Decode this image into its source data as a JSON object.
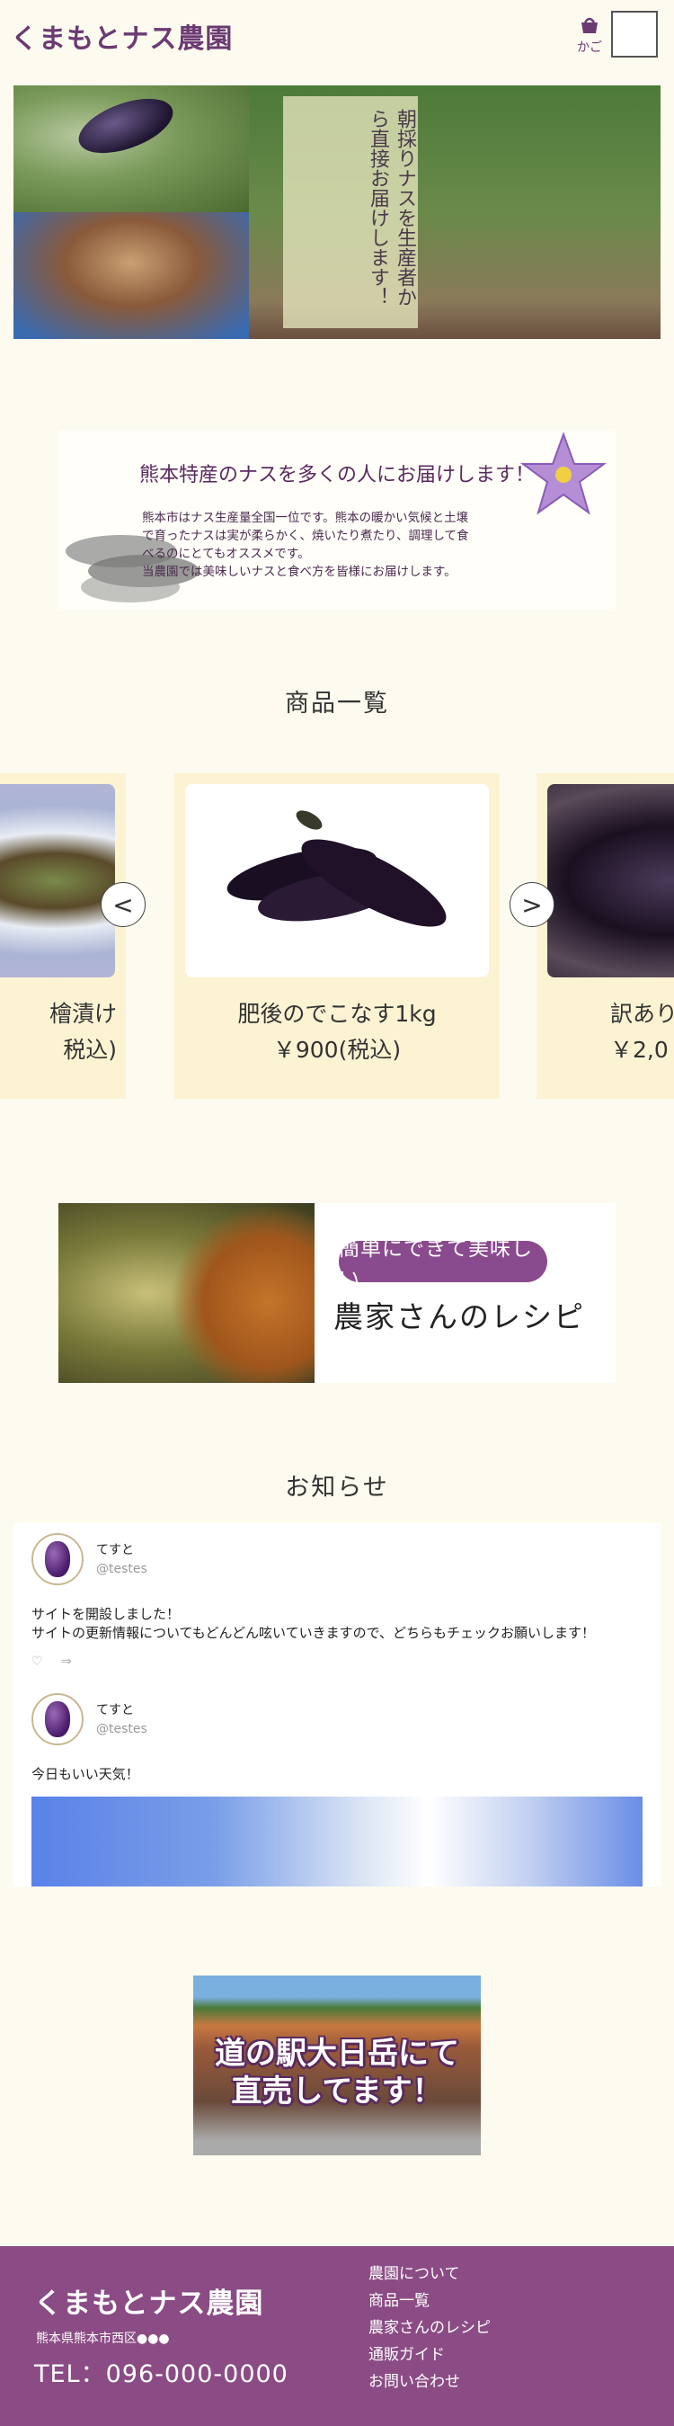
{
  "header": {
    "logo": "くまもとナス農園",
    "cart_label": "かご"
  },
  "hero": {
    "banner_text": "朝採りナスを生産者から直接お届けします！"
  },
  "intro": {
    "title": "熊本特産のナスを多くの人にお届けします！",
    "body_lines": [
      "熊本市はナス生産量全国一位です。熊本の暖かい気候と土壌",
      "で育ったナスは実が柔らかく、焼いたり煮たり、調理して食",
      "べるのにとてもオススメです。",
      "当農園では美味しいナスと食べ方を皆様にお届けします。"
    ]
  },
  "products": {
    "title": "商品一覧",
    "items": [
      {
        "name": "檜漬け",
        "price": "税込)"
      },
      {
        "name": "肥後のでこなす1kg",
        "price": "￥900(税込)"
      },
      {
        "name": "訳あり",
        "price": "￥2,0"
      }
    ],
    "prev_icon": "<",
    "next_icon": ">"
  },
  "recipe": {
    "pill": "簡単にできて美味しい",
    "title": "農家さんのレシピ"
  },
  "news": {
    "title": "お知らせ",
    "posts": [
      {
        "name": "てすと",
        "handle": "@testes",
        "lines": [
          "サイトを開設しました！",
          "サイトの更新情報についてもどんどん呟いていきますので、どちらもチェックお願いします！"
        ],
        "like_icon": "♡",
        "share_icon": "⇒"
      },
      {
        "name": "てすと",
        "handle": "@testes",
        "lines": [
          "今日もいい天気！"
        ]
      }
    ]
  },
  "station": {
    "lines": [
      "道の駅大日岳にて",
      "直売してます！"
    ]
  },
  "footer": {
    "logo": "くまもとナス農園",
    "address": "熊本県熊本市西区●●●",
    "tel": "TEL：096-000-0000",
    "nav": [
      "農園について",
      "商品一覧",
      "農家さんのレシピ",
      "通販ガイド",
      "お問い合わせ"
    ]
  },
  "colors": {
    "brand_purple": "#8b4c85",
    "accent_dark_purple": "#6b3a73",
    "background_cream": "#fdfbef",
    "card_cream": "#fcf3d3"
  },
  "icons": {
    "cart": "shopping-basket-icon",
    "menu": "menu-icon"
  }
}
